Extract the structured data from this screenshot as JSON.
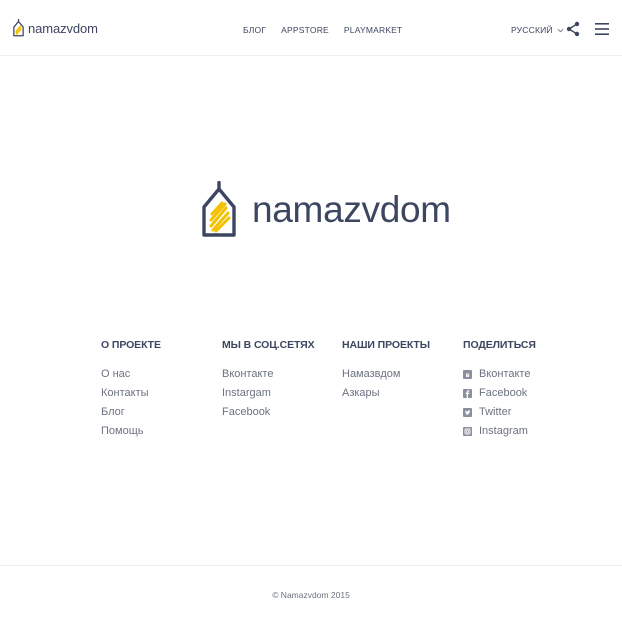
{
  "header": {
    "brand_name": "namazvdom",
    "nav": [
      {
        "label": "БЛОГ"
      },
      {
        "label": "APPSTORE"
      },
      {
        "label": "PLAYMARKET"
      }
    ],
    "language": "РУССКИЙ"
  },
  "hero": {
    "brand_name": "namazvdom"
  },
  "footer": {
    "columns": [
      {
        "title": "О ПРОЕКТЕ",
        "links": [
          {
            "label": "О нас"
          },
          {
            "label": "Контакты"
          },
          {
            "label": "Блог"
          },
          {
            "label": "Помощь"
          }
        ]
      },
      {
        "title": "МЫ В СОЦ.СЕТЯХ",
        "links": [
          {
            "label": "Вконтакте"
          },
          {
            "label": "Instargam"
          },
          {
            "label": "Facebook"
          }
        ]
      },
      {
        "title": "НАШИ ПРОЕКТЫ",
        "links": [
          {
            "label": "Намазвдом"
          },
          {
            "label": "Азкары"
          }
        ]
      },
      {
        "title": "ПОДЕЛИТЬСЯ",
        "links": [
          {
            "label": "Вконтакте",
            "icon": "vk-icon"
          },
          {
            "label": "Facebook",
            "icon": "facebook-icon"
          },
          {
            "label": "Twitter",
            "icon": "twitter-icon"
          },
          {
            "label": "Instagram",
            "icon": "instagram-icon"
          }
        ]
      }
    ],
    "copyright": "© Namazvdom 2015"
  },
  "colors": {
    "brand_navy": "#3d4660",
    "brand_yellow": "#f2c200",
    "text_muted": "#6c7281",
    "divider": "#ececec"
  }
}
